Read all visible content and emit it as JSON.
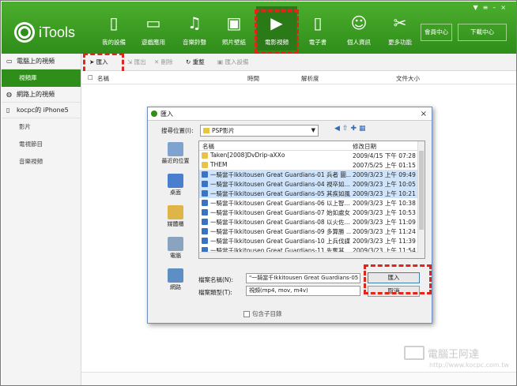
{
  "app": {
    "name": "iTools"
  },
  "nav": [
    {
      "label": "我的設備",
      "icon": "phone-icon"
    },
    {
      "label": "遊戲應用",
      "icon": "apps-icon"
    },
    {
      "label": "音樂鈴聲",
      "icon": "music-icon"
    },
    {
      "label": "照片壁紙",
      "icon": "photo-icon"
    },
    {
      "label": "電影視頻",
      "icon": "play-icon"
    },
    {
      "label": "電子書",
      "icon": "book-icon"
    },
    {
      "label": "個人資訊",
      "icon": "person-icon"
    },
    {
      "label": "更多功能",
      "icon": "tools-icon"
    }
  ],
  "header": {
    "member": "會員中心",
    "download": "下載中心"
  },
  "sidebar": {
    "local_title": "電腦上的視頻",
    "local_items": [
      "視頻庫"
    ],
    "online_title": "網路上的視頻",
    "device_title": "kocpc的 iPhone5",
    "device_items": [
      "影片",
      "電視節目",
      "音樂視頻"
    ]
  },
  "toolbar": {
    "import": "匯入",
    "export": "匯出",
    "delete": "刪除",
    "refresh": "重整",
    "import_device": "匯入設備"
  },
  "columns": {
    "name": "名稱",
    "time": "時間",
    "resolution": "解析度",
    "size": "文件大小"
  },
  "dialog": {
    "title": "匯入",
    "lookin_label": "搜尋位置(I):",
    "lookin_value": "PSP影片",
    "places": [
      "最近的位置",
      "桌面",
      "媒體櫃",
      "電腦",
      "網路"
    ],
    "list_header": {
      "name": "名稱",
      "date": "修改日期"
    },
    "files": [
      {
        "name": "Taken[2008]DvDrip-aXXo",
        "date": "2009/4/15 下午 07:28",
        "type": "dir"
      },
      {
        "name": "THEM",
        "date": "2007/5/25 上午 01:15",
        "type": "dir"
      },
      {
        "name": "一騎當千Ikkitousen Great Guardians-01 兵者 圖...",
        "date": "2009/3/23 上午 09:49",
        "type": "file",
        "sel": true
      },
      {
        "name": "一騎當千Ikkitousen Great Guardians-04 視卒如...",
        "date": "2009/3/23 上午 10:05",
        "type": "file",
        "sel": true
      },
      {
        "name": "一騎當千Ikkitousen Great Guardians-05 其疾如風 ...",
        "date": "2009/3/23 上午 10:21",
        "type": "file",
        "sel": true
      },
      {
        "name": "一騎當千Ikkitousen Great Guardians-06 以上智...",
        "date": "2009/3/23 上午 10:38",
        "type": "file"
      },
      {
        "name": "一騎當千Ikkitousen Great Guardians-07 始如處女",
        "date": "2009/3/23 上午 10:53",
        "type": "file"
      },
      {
        "name": "一騎當千Ikkitousen Great Guardians-08 以火佐...",
        "date": "2009/3/23 上午 11:09",
        "type": "file"
      },
      {
        "name": "一騎當千Ikkitousen Great Guardians-09 多算勝 ...",
        "date": "2009/3/23 上午 11:24",
        "type": "file"
      },
      {
        "name": "一騎當千Ikkitousen Great Guardians-10 上兵伐謀",
        "date": "2009/3/23 上午 11:39",
        "type": "file"
      },
      {
        "name": "一騎當千Ikkitousen Great Guardians-11 先奪其...",
        "date": "2009/3/23 上午 11:54",
        "type": "file"
      }
    ],
    "filename_label": "檔案名稱(N):",
    "filename_value": "\"一騎當千Ikkitousen Great Guardians-05 其疾如",
    "filetype_label": "檔案類型(T):",
    "filetype_value": "視頻(mp4, mov, m4v)",
    "import_button": "匯入",
    "cancel_button": "取消",
    "subdir_label": "包含子目錄"
  },
  "watermark": {
    "title": "電腦王阿達",
    "url": "http://www.kocpc.com.tw"
  }
}
